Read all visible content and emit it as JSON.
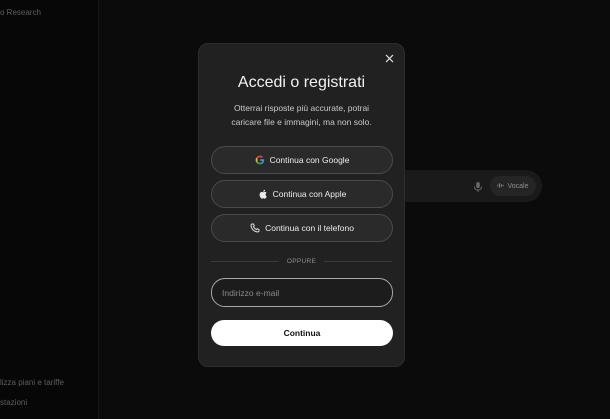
{
  "sidebar": {
    "top_item": "o Research",
    "bottom_items": [
      "lizza piani e tariffe",
      "stazioni"
    ]
  },
  "background": {
    "voice_label": "Vocale"
  },
  "modal": {
    "title": "Accedi o registrati",
    "subtitle": "Otterrai risposte più accurate, potrai caricare file e immagini, ma non solo.",
    "google_label": "Continua con Google",
    "apple_label": "Continua con Apple",
    "phone_label": "Continua con il telefono",
    "divider_label": "OPPURE",
    "email_placeholder": "Indirizzo e-mail",
    "continue_label": "Continua"
  },
  "icons": {
    "close": "close-icon",
    "google": "google-icon",
    "apple": "apple-icon",
    "phone": "phone-icon",
    "mic": "mic-icon",
    "voice": "waveform-icon"
  },
  "colors": {
    "modal_bg": "#212121",
    "primary_button_bg": "#ffffff",
    "page_bg": "#0d0d0d"
  }
}
